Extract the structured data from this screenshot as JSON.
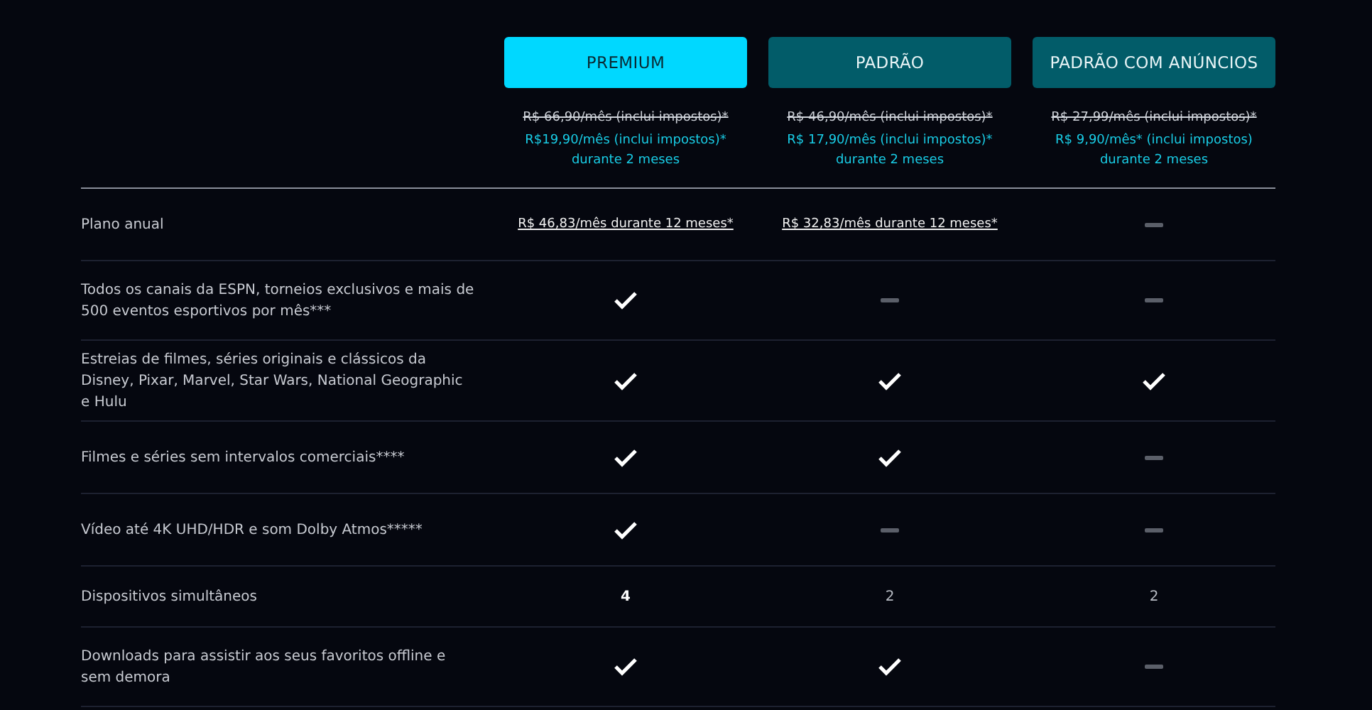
{
  "plans": [
    {
      "name": "PREMIUM",
      "selected": true,
      "old_price": "R$ 66,90/mês (inclui impostos)*",
      "promo_price": "R$19,90/mês (inclui impostos)* durante 2 meses"
    },
    {
      "name": "PADRÃO",
      "selected": false,
      "old_price": "R$ 46,90/mês (inclui impostos)*",
      "promo_price": "R$ 17,90/mês (inclui impostos)* durante 2 meses"
    },
    {
      "name": "PADRÃO COM ANÚNCIOS",
      "selected": false,
      "old_price": "R$ 27,99/mês (inclui impostos)*",
      "promo_price": "R$ 9,90/mês* (inclui impostos) durante 2 meses"
    }
  ],
  "rows": [
    {
      "label": "Plano anual",
      "cells": [
        {
          "kind": "link",
          "text": "R$ 46,83/mês durante 12 meses*"
        },
        {
          "kind": "link",
          "text": "R$ 32,83/mês durante 12 meses*"
        },
        {
          "kind": "dash"
        }
      ]
    },
    {
      "label": "Todos os canais da ESPN, torneios exclusivos e mais de 500 eventos esportivos por mês***",
      "cells": [
        {
          "kind": "check"
        },
        {
          "kind": "dash"
        },
        {
          "kind": "dash"
        }
      ]
    },
    {
      "label": "Estreias de filmes, séries originais e clássicos da Disney, Pixar, Marvel, Star Wars, National Geographic e Hulu",
      "cells": [
        {
          "kind": "check"
        },
        {
          "kind": "check"
        },
        {
          "kind": "check"
        }
      ]
    },
    {
      "label": "Filmes e séries sem intervalos comerciais****",
      "cells": [
        {
          "kind": "check"
        },
        {
          "kind": "check"
        },
        {
          "kind": "dash"
        }
      ]
    },
    {
      "label": "Vídeo até 4K UHD/HDR e som Dolby Atmos*****",
      "cells": [
        {
          "kind": "check"
        },
        {
          "kind": "dash"
        },
        {
          "kind": "dash"
        }
      ]
    },
    {
      "label": "Dispositivos simultâneos",
      "cells": [
        {
          "kind": "text",
          "text": "4"
        },
        {
          "kind": "text",
          "text": "2"
        },
        {
          "kind": "text",
          "text": "2"
        }
      ]
    },
    {
      "label": "Downloads para assistir aos seus favoritos offline e sem demora",
      "cells": [
        {
          "kind": "check"
        },
        {
          "kind": "check"
        },
        {
          "kind": "dash"
        }
      ]
    }
  ]
}
